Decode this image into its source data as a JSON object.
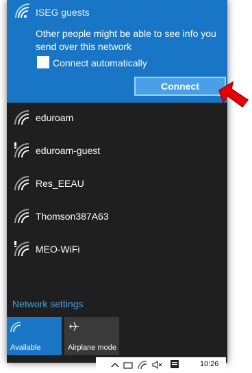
{
  "selected_network": {
    "name": "ISEG guests",
    "warning": "Other people might be able to see info you send over this network",
    "connect_auto_label": "Connect automatically",
    "connect_auto_checked": false,
    "connect_button": "Connect"
  },
  "networks": [
    {
      "name": "eduroam",
      "icon": "wifi-icon",
      "secured": true
    },
    {
      "name": "eduroam-guest",
      "icon": "wifi-warning-icon",
      "secured": false
    },
    {
      "name": "Res_EEAU",
      "icon": "wifi-icon",
      "secured": true
    },
    {
      "name": "Thomson387A63",
      "icon": "wifi-icon",
      "secured": true
    },
    {
      "name": "MEO-WiFi",
      "icon": "wifi-warning-icon",
      "secured": false
    }
  ],
  "network_settings_label": "Network settings",
  "quick_actions": [
    {
      "label": "Available",
      "icon": "wifi-icon",
      "active": true
    },
    {
      "label": "Airplane mode",
      "icon": "airplane-icon",
      "active": false
    }
  ],
  "taskbar": {
    "time": "10:26"
  },
  "colors": {
    "accent": "#1975c5",
    "panel": "#1f1f1f",
    "annotation_arrow": "#e60000"
  }
}
